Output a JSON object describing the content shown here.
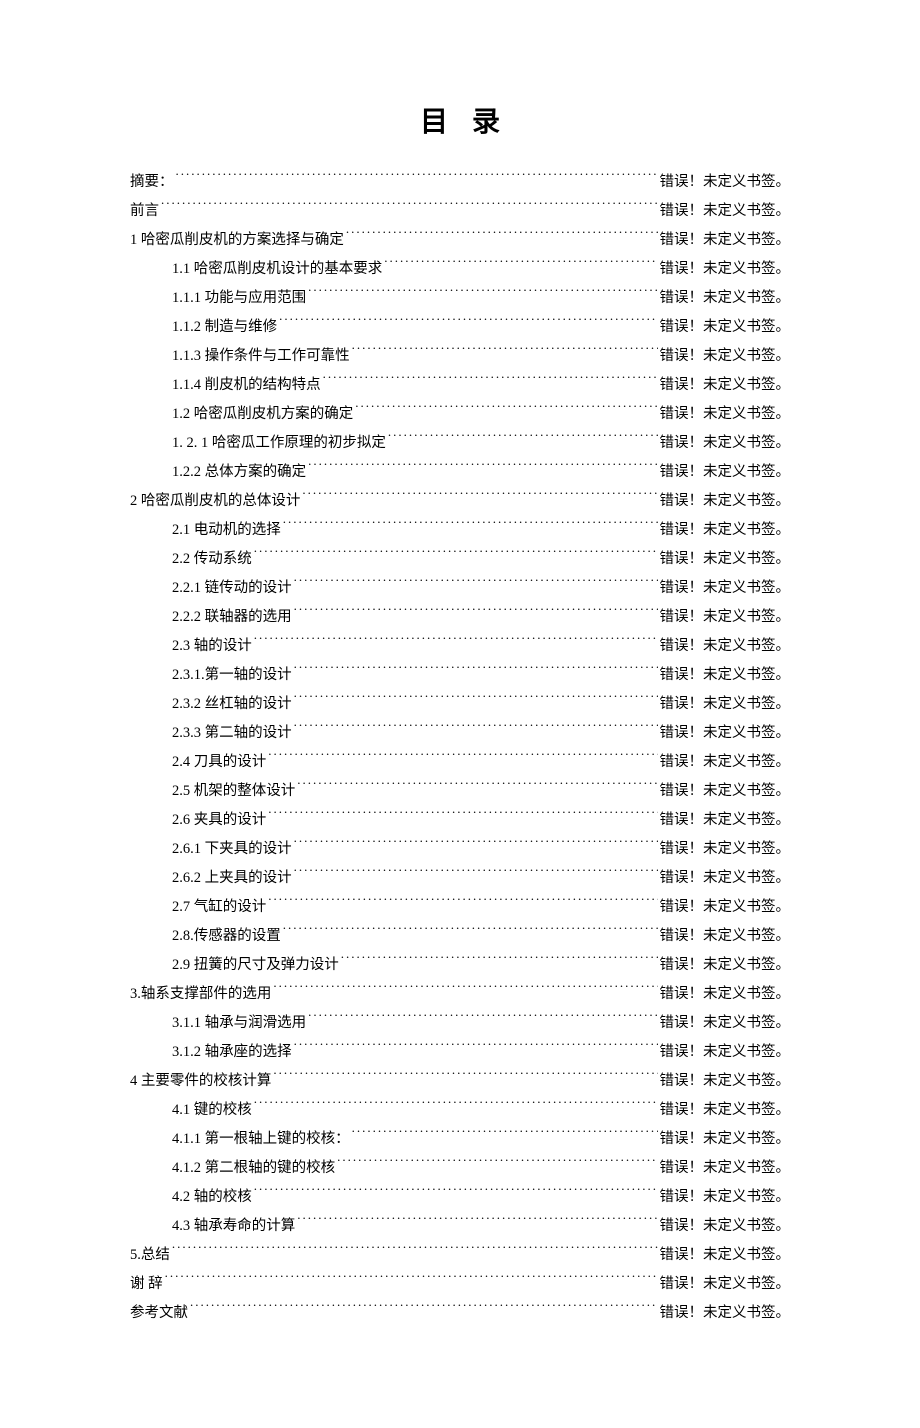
{
  "title": "目录",
  "page_text": "错误！未定义书签。",
  "toc": [
    {
      "label": "摘要：",
      "indent": 0
    },
    {
      "label": "前言",
      "indent": 0
    },
    {
      "label": "1 哈密瓜削皮机的方案选择与确定",
      "indent": 0
    },
    {
      "label": "1.1 哈密瓜削皮机设计的基本要求",
      "indent": 1
    },
    {
      "label": "1.1.1 功能与应用范围",
      "indent": 1
    },
    {
      "label": "1.1.2 制造与维修",
      "indent": 1
    },
    {
      "label": "1.1.3 操作条件与工作可靠性",
      "indent": 1
    },
    {
      "label": "1.1.4 削皮机的结构特点",
      "indent": 1
    },
    {
      "label": "1.2 哈密瓜削皮机方案的确定",
      "indent": 1
    },
    {
      "label": "1. 2. 1 哈密瓜工作原理的初步拟定",
      "indent": 1
    },
    {
      "label": "1.2.2 总体方案的确定",
      "indent": 1
    },
    {
      "label": "2 哈密瓜削皮机的总体设计",
      "indent": 0
    },
    {
      "label": "2.1 电动机的选择",
      "indent": 1
    },
    {
      "label": "2.2 传动系统",
      "indent": 1
    },
    {
      "label": "2.2.1 链传动的设计",
      "indent": 1
    },
    {
      "label": "2.2.2 联轴器的选用",
      "indent": 1
    },
    {
      "label": "2.3 轴的设计",
      "indent": 1
    },
    {
      "label": "2.3.1.第一轴的设计",
      "indent": 1
    },
    {
      "label": "2.3.2 丝杠轴的设计",
      "indent": 1
    },
    {
      "label": "2.3.3 第二轴的设计",
      "indent": 1
    },
    {
      "label": "2.4 刀具的设计",
      "indent": 1
    },
    {
      "label": "2.5 机架的整体设计",
      "indent": 1
    },
    {
      "label": "2.6 夹具的设计",
      "indent": 1
    },
    {
      "label": "2.6.1 下夹具的设计",
      "indent": 1
    },
    {
      "label": "2.6.2 上夹具的设计",
      "indent": 1
    },
    {
      "label": "2.7 气缸的设计",
      "indent": 1
    },
    {
      "label": "2.8.传感器的设置",
      "indent": 1
    },
    {
      "label": "2.9 扭簧的尺寸及弹力设计",
      "indent": 1
    },
    {
      "label": "3.轴系支撑部件的选用",
      "indent": 0
    },
    {
      "label": "3.1.1 轴承与润滑选用",
      "indent": 1
    },
    {
      "label": "3.1.2 轴承座的选择",
      "indent": 1
    },
    {
      "label": "4 主要零件的校核计算",
      "indent": 0
    },
    {
      "label": "4.1 键的校核",
      "indent": 1
    },
    {
      "label": "4.1.1 第一根轴上键的校核：",
      "indent": 1
    },
    {
      "label": "4.1.2 第二根轴的键的校核",
      "indent": 1
    },
    {
      "label": "4.2 轴的校核",
      "indent": 1
    },
    {
      "label": "4.3 轴承寿命的计算",
      "indent": 1
    },
    {
      "label": "5.总结",
      "indent": 0
    },
    {
      "label": "谢  辞",
      "indent": 0
    },
    {
      "label": "参考文献",
      "indent": 0
    }
  ]
}
